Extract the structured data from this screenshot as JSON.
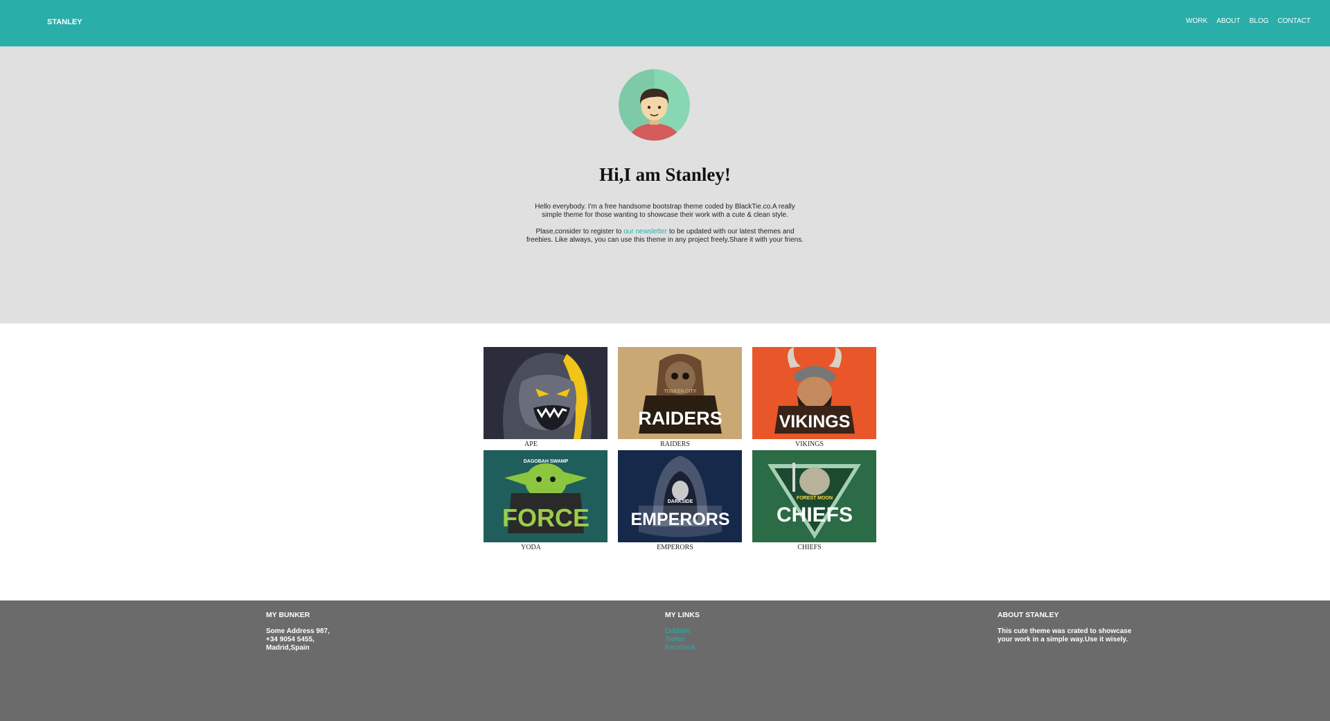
{
  "brand": "STANLEY",
  "nav": [
    "WORK",
    "ABOUT",
    "BLOG",
    "CONTACT"
  ],
  "hero": {
    "title": "Hi,I am Stanley!",
    "para1_line1": "Hello everybody. I'm a free handsome bootstrap theme coded by BlackTie.co.A really",
    "para1_line2": "simple theme for those wanting to showcase their work with a cute & clean style.",
    "para2_pre": "Plase,consider to register to ",
    "para2_link": "our newsletter",
    "para2_post": " to be updated with our latest themes and",
    "para2_line2": "freebies. Like always, you can use this theme in any project freely.Share it with your friens."
  },
  "portfolio": [
    {
      "caption": "APE"
    },
    {
      "caption": "RAIDERS"
    },
    {
      "caption": "VIKINGS"
    },
    {
      "caption": "YODA"
    },
    {
      "caption": "EMPERORS"
    },
    {
      "caption": "CHIEFS"
    }
  ],
  "logo_text": {
    "raiders_small": "TUSKEN CITY",
    "raiders": "RAIDERS",
    "vikings": "VIKINGS",
    "force_small": "DAGOBAH SWAMP",
    "force": "FORCE",
    "emperors_small": "DARKSIDE",
    "emperors": "EMPERORS",
    "chiefs_small": "FOREST MOON",
    "chiefs": "CHIEFS"
  },
  "footer": {
    "col1": {
      "title": "MY BUNKER",
      "lines": [
        "Some Address 987,",
        "+34 9054 5455,",
        "Madrid,Spain"
      ]
    },
    "col2": {
      "title": "MY LINKS",
      "links": [
        "Dribbble",
        "Twitter",
        "Facebook"
      ]
    },
    "col3": {
      "title": "ABOUT STANLEY",
      "lines": [
        "This cute theme was crated to showcase",
        "your work in a simple way.Use it wisely."
      ]
    }
  },
  "colors": {
    "accent": "#2aaea9",
    "hero_bg": "#e0e0e0",
    "footer_bg": "#6b6b6b"
  }
}
